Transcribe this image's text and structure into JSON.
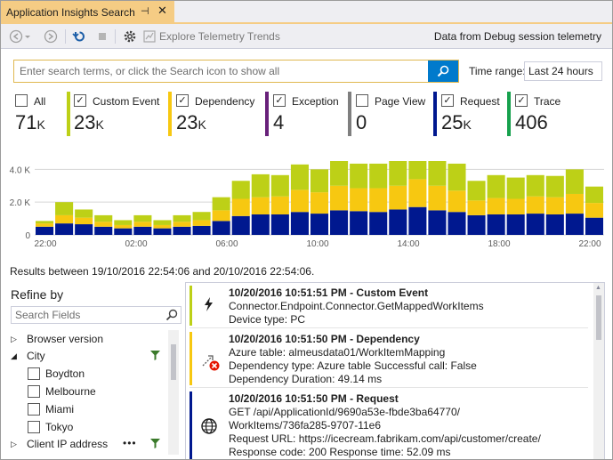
{
  "tab": {
    "title": "Application Insights Search",
    "pin_glyph": "⊣",
    "close_glyph": "✕"
  },
  "toolbar": {
    "back_icon": "back-arrow-icon",
    "forward_icon": "forward-arrow-icon",
    "refresh_icon": "refresh-icon",
    "stop_icon": "stop-icon",
    "settings_icon": "gear-icon",
    "explore_label": "Explore Telemetry Trends",
    "data_source": "Data from Debug session telemetry"
  },
  "search": {
    "placeholder": "Enter search terms, or click the Search icon to show all",
    "value": ""
  },
  "time_range": {
    "label": "Time range:",
    "value": "Last 24 hours"
  },
  "filters": [
    {
      "label": "All",
      "count": "71",
      "unit": "K",
      "checked": false,
      "color": "#ffffff"
    },
    {
      "label": "Custom Event",
      "count": "23",
      "unit": "K",
      "checked": true,
      "color": "#bdd017"
    },
    {
      "label": "Dependency",
      "count": "23",
      "unit": "K",
      "checked": true,
      "color": "#f7c811"
    },
    {
      "label": "Exception",
      "count": "4",
      "unit": "",
      "checked": true,
      "color": "#68217a"
    },
    {
      "label": "Page View",
      "count": "0",
      "unit": "",
      "checked": false,
      "color": "#7f7f7f"
    },
    {
      "label": "Request",
      "count": "25",
      "unit": "K",
      "checked": true,
      "color": "#00188f"
    },
    {
      "label": "Trace",
      "count": "406",
      "unit": "",
      "checked": true,
      "color": "#16a14d"
    }
  ],
  "colors": {
    "accent": "#007acc",
    "tab": "#f5cc84",
    "request": "#00188f",
    "dependency": "#f7c811",
    "custom_event": "#bdd017"
  },
  "chart_data": {
    "type": "bar",
    "stacked": true,
    "y_ticks": [
      "4.0 K",
      "2.0 K",
      "0"
    ],
    "ylim": [
      0,
      4400
    ],
    "x_ticks": [
      "22:00",
      "02:00",
      "06:00",
      "10:00",
      "14:00",
      "18:00",
      "22:00"
    ],
    "series": [
      {
        "name": "Request",
        "color": "#00188f",
        "values": [
          500,
          700,
          650,
          500,
          400,
          500,
          400,
          500,
          550,
          850,
          1150,
          1250,
          1250,
          1400,
          1300,
          1500,
          1450,
          1400,
          1550,
          1700,
          1500,
          1400,
          1200,
          1250,
          1250,
          1300,
          1250,
          1300,
          1050
        ]
      },
      {
        "name": "Dependency",
        "color": "#f7c811",
        "values": [
          200,
          500,
          400,
          300,
          200,
          300,
          200,
          300,
          350,
          650,
          1050,
          1050,
          1100,
          1350,
          1300,
          1500,
          1400,
          1450,
          1450,
          1700,
          1500,
          1300,
          900,
          1000,
          950,
          1050,
          1050,
          1200,
          900
        ]
      },
      {
        "name": "Custom Event",
        "color": "#bdd017",
        "values": [
          150,
          800,
          500,
          400,
          300,
          400,
          300,
          400,
          500,
          800,
          1100,
          1400,
          1300,
          1550,
          1400,
          1800,
          1500,
          1500,
          1750,
          1750,
          1600,
          1650,
          1200,
          1400,
          1300,
          1300,
          1300,
          1500,
          1000
        ]
      }
    ]
  },
  "results_summary": "Results between 19/10/2016 22:54:06 and 20/10/2016 22:54:06.",
  "refine": {
    "title": "Refine by",
    "search_placeholder": "Search Fields",
    "tree": [
      {
        "label": "Browser version",
        "expanded": false
      },
      {
        "label": "City",
        "expanded": true
      },
      {
        "label": "Boydton",
        "child": true
      },
      {
        "label": "Melbourne",
        "child": true
      },
      {
        "label": "Miami",
        "child": true
      },
      {
        "label": "Tokyo",
        "child": true
      },
      {
        "label": "Client IP address",
        "expanded": false
      }
    ],
    "more_glyph": "•••"
  },
  "results": [
    {
      "heading": "10/20/2016 10:51:51 PM - Custom Event",
      "lines": [
        "Connector.Endpoint.Connector.GetMappedWorkItems",
        "Device type: PC"
      ],
      "icon": "lightning-icon",
      "color": "#bdd017"
    },
    {
      "heading": "10/20/2016 10:51:50 PM - Dependency",
      "lines": [
        "Azure table: almeusdata01/WorkItemMapping",
        "Dependency type: Azure table Successful call: False",
        "Dependency Duration: 49.14 ms"
      ],
      "icon": "dependency-failed-icon",
      "color": "#f7c811"
    },
    {
      "heading": "10/20/2016 10:51:50 PM - Request",
      "lines": [
        "GET /api/ApplicationId/9690a53e-fbde3ba64770/",
        "WorkItems/736fa285-9707-11e6",
        "Request URL: https://icecream.fabrikam.com/api/customer/create/",
        "Response code: 200 Response time: 52.09 ms"
      ],
      "icon": "globe-icon",
      "color": "#00188f"
    }
  ]
}
